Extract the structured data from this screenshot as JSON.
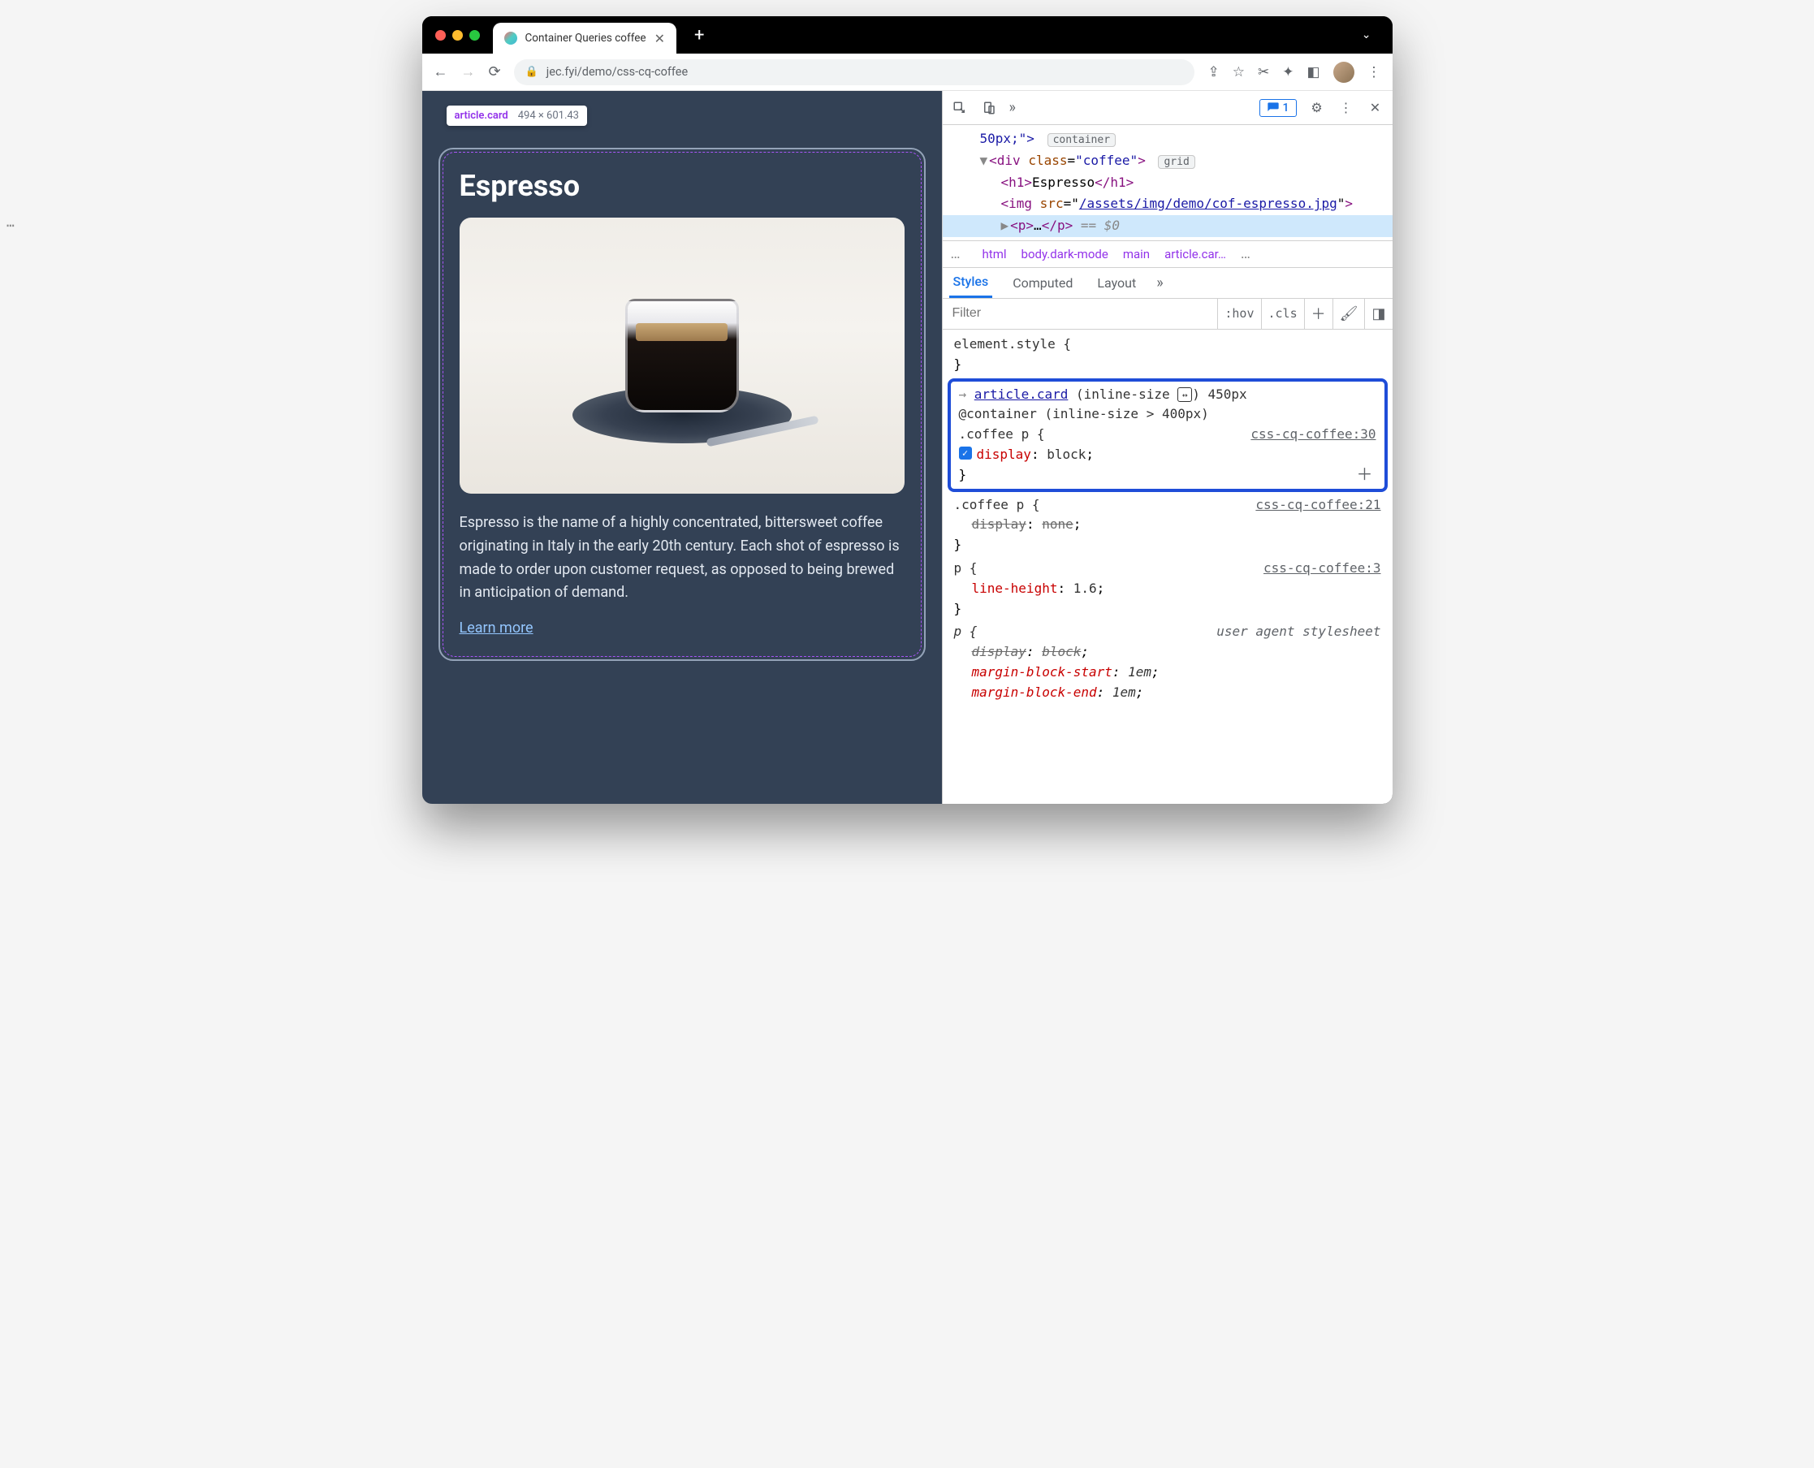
{
  "window": {
    "tab_title": "Container Queries coffee",
    "new_tab_label": "+"
  },
  "url": {
    "text": "jec.fyi/demo/css-cq-coffee"
  },
  "page": {
    "tooltip_selector": "article.card",
    "tooltip_dims": "494 × 601.43",
    "card_title": "Espresso",
    "card_body": "Espresso is the name of a highly concentrated, bittersweet coffee originating in Italy in the early 20th century. Each shot of espresso is made to order upon customer request, as opposed to being brewed in anticipation of demand.",
    "learn_more": "Learn more"
  },
  "devtools": {
    "issues_count": "1",
    "elements": {
      "line0": "50px;\">",
      "badge0": "container",
      "div_open": "<div class=\"coffee\">",
      "badge1": "grid",
      "h1": "<h1>Espresso</h1>",
      "img_a": "<img src=\"",
      "img_link": "/assets/img/demo/cof-espresso.jpg",
      "img_b": "\">",
      "p_collapsed": "<p>…</p>",
      "eq0": "== $0"
    },
    "crumbs": [
      "html",
      "body.dark-mode",
      "main",
      "article.car…"
    ],
    "styles_tabs": [
      "Styles",
      "Computed",
      "Layout"
    ],
    "filter_placeholder": "Filter",
    "hov": ":hov",
    "cls": ".cls",
    "rules": {
      "element_style": "element.style {",
      "cq_selector": "article.card",
      "cq_size": "(inline-size",
      "cq_val": ") 450px",
      "container_at": "@container (inline-size > 400px)",
      "r1_sel": ".coffee p {",
      "r1_src": "css-cq-coffee:30",
      "r1_prop_n": "display",
      "r1_prop_v": "block",
      "r2_sel": ".coffee p {",
      "r2_src": "css-cq-coffee:21",
      "r2_prop_n": "display",
      "r2_prop_v": "none",
      "r3_sel": "p {",
      "r3_src": "css-cq-coffee:3",
      "r3_prop_n": "line-height",
      "r3_prop_v": "1.6",
      "r4_sel": "p {",
      "r4_ua": "user agent stylesheet",
      "r4a_n": "display",
      "r4a_v": "block",
      "r4b_n": "margin-block-start",
      "r4b_v": "1em",
      "r4c_n": "margin-block-end",
      "r4c_v": "1em"
    }
  }
}
